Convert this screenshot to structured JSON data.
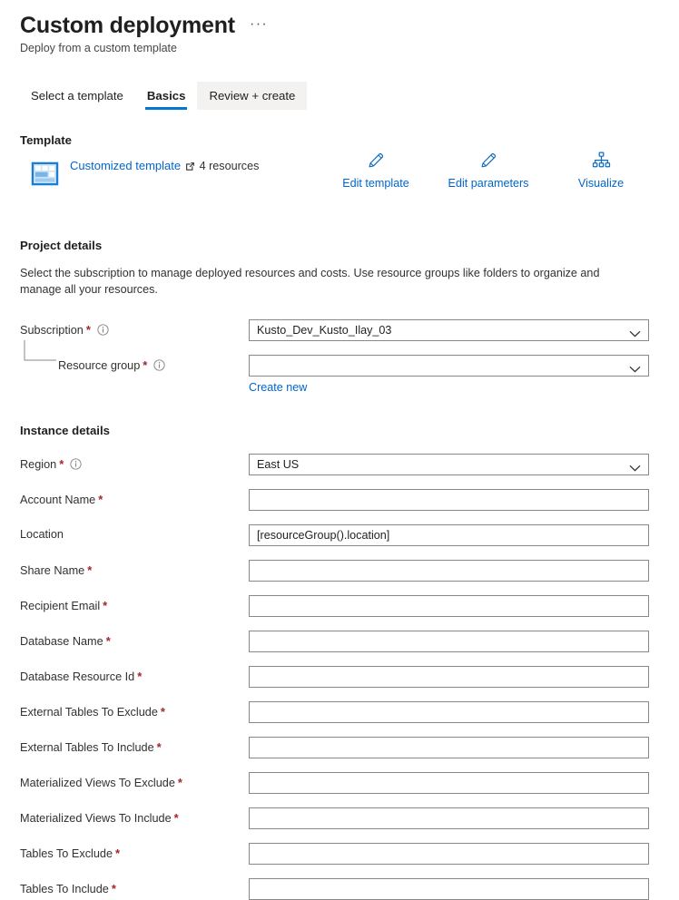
{
  "header": {
    "title": "Custom deployment",
    "subtitle": "Deploy from a custom template",
    "more_menu": "···"
  },
  "tabs": [
    {
      "label": "Select a template",
      "state": "normal"
    },
    {
      "label": "Basics",
      "state": "selected"
    },
    {
      "label": "Review + create",
      "state": "hovered"
    }
  ],
  "template_section": {
    "heading": "Template",
    "link_label": "Customized template",
    "resources_count": "4 resources",
    "link_icon": "external-link-icon",
    "template_icon": "template-grid-icon"
  },
  "actions": [
    {
      "label": "Edit template",
      "icon": "pencil-icon"
    },
    {
      "label": "Edit parameters",
      "icon": "pencil-icon"
    },
    {
      "label": "Visualize",
      "icon": "hierarchy-icon"
    }
  ],
  "project_details": {
    "heading": "Project details",
    "description": "Select the subscription to manage deployed resources and costs. Use resource groups like folders to organize and manage all your resources.",
    "fields": [
      {
        "name": "subscription",
        "label": "Subscription",
        "required": true,
        "info": true,
        "control": "select",
        "value": "Kusto_Dev_Kusto_Ilay_03",
        "placeholder": ""
      },
      {
        "name": "resource-group",
        "label": "Resource group",
        "required": true,
        "info": true,
        "control": "select",
        "value": "",
        "placeholder": "",
        "indented": true,
        "sub_link": "Create new"
      }
    ]
  },
  "instance_details": {
    "heading": "Instance details",
    "fields": [
      {
        "name": "region",
        "label": "Region",
        "required": true,
        "info": true,
        "control": "select",
        "value": "East US",
        "placeholder": ""
      },
      {
        "name": "account-name",
        "label": "Account Name",
        "required": true,
        "info": false,
        "control": "text",
        "value": "",
        "placeholder": ""
      },
      {
        "name": "location",
        "label": "Location",
        "required": false,
        "info": false,
        "control": "text",
        "value": "[resourceGroup().location]",
        "placeholder": ""
      },
      {
        "name": "share-name",
        "label": "Share Name",
        "required": true,
        "info": false,
        "control": "text",
        "value": "",
        "placeholder": ""
      },
      {
        "name": "recipient-email",
        "label": "Recipient Email",
        "required": true,
        "info": false,
        "control": "text",
        "value": "",
        "placeholder": ""
      },
      {
        "name": "database-name",
        "label": "Database Name",
        "required": true,
        "info": false,
        "control": "text",
        "value": "",
        "placeholder": ""
      },
      {
        "name": "database-resource-id",
        "label": "Database Resource Id",
        "required": true,
        "info": false,
        "control": "text",
        "value": "",
        "placeholder": ""
      },
      {
        "name": "external-tables-to-exclude",
        "label": "External Tables To Exclude",
        "required": true,
        "info": false,
        "control": "text",
        "value": "",
        "placeholder": ""
      },
      {
        "name": "external-tables-to-include",
        "label": "External Tables To Include",
        "required": true,
        "info": false,
        "control": "text",
        "value": "",
        "placeholder": ""
      },
      {
        "name": "materialized-views-to-exclude",
        "label": "Materialized Views To Exclude",
        "required": true,
        "info": false,
        "control": "text",
        "value": "",
        "placeholder": ""
      },
      {
        "name": "materialized-views-to-include",
        "label": "Materialized Views To Include",
        "required": true,
        "info": false,
        "control": "text",
        "value": "",
        "placeholder": ""
      },
      {
        "name": "tables-to-exclude",
        "label": "Tables To Exclude",
        "required": true,
        "info": false,
        "control": "text",
        "value": "",
        "placeholder": ""
      },
      {
        "name": "tables-to-include",
        "label": "Tables To Include",
        "required": true,
        "info": false,
        "control": "text",
        "value": "",
        "placeholder": ""
      }
    ]
  },
  "colors": {
    "accent": "#0078d4",
    "link": "#0066cc",
    "required_asterisk": "#a4262c",
    "border": "#8a8886",
    "text": "#201f1e",
    "tab_hover_bg": "#f3f2f1"
  }
}
